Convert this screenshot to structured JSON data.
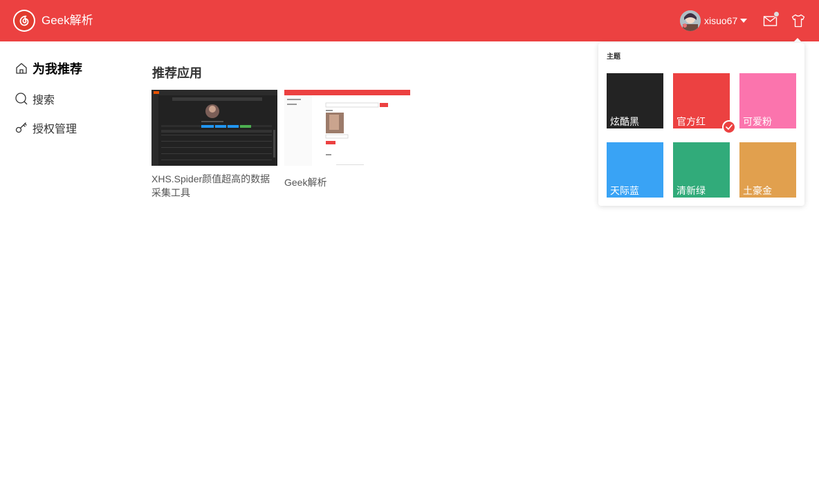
{
  "header": {
    "app_title": "Geek解析",
    "username": "xisuo67",
    "logo_icon": "netease-music-logo-icon",
    "mail_icon": "mail-icon",
    "theme_icon": "tshirt-icon",
    "brand_color": "#ec4141"
  },
  "sidebar": {
    "items": [
      {
        "label": "为我推荐",
        "icon": "home-icon",
        "active": true
      },
      {
        "label": "搜索",
        "icon": "search-icon",
        "active": false
      },
      {
        "label": "授权管理",
        "icon": "key-icon",
        "active": false
      }
    ]
  },
  "main": {
    "section_title": "推荐应用",
    "cards": [
      {
        "caption": "XHS.Spider颜值超高的数据采集工具"
      },
      {
        "caption": "Geek解析"
      }
    ]
  },
  "theme_popup": {
    "title": "主题",
    "themes": [
      {
        "name": "炫酷黑",
        "color": "#232323",
        "selected": false
      },
      {
        "name": "官方红",
        "color": "#ec4141",
        "selected": true
      },
      {
        "name": "可爱粉",
        "color": "#fb74ad",
        "selected": false
      },
      {
        "name": "天际蓝",
        "color": "#39a3f5",
        "selected": false
      },
      {
        "name": "清新绿",
        "color": "#31ab7a",
        "selected": false
      },
      {
        "name": "土豪金",
        "color": "#e1a04e",
        "selected": false
      }
    ]
  }
}
